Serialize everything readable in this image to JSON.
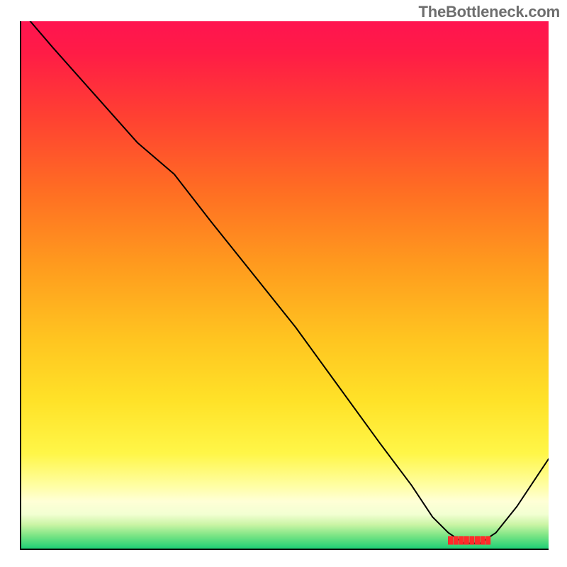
{
  "attribution": "TheBottleneck.com",
  "chart_data": {
    "type": "line",
    "title": "",
    "xlabel": "",
    "ylabel": "",
    "xlim": [
      0,
      100
    ],
    "ylim": [
      0,
      100
    ],
    "background_gradient": {
      "stops": [
        {
          "offset": 0.0,
          "color": "#ff1450"
        },
        {
          "offset": 0.06,
          "color": "#ff1c46"
        },
        {
          "offset": 0.18,
          "color": "#ff4032"
        },
        {
          "offset": 0.32,
          "color": "#ff6d23"
        },
        {
          "offset": 0.46,
          "color": "#ff9a1e"
        },
        {
          "offset": 0.6,
          "color": "#ffc420"
        },
        {
          "offset": 0.72,
          "color": "#ffe228"
        },
        {
          "offset": 0.82,
          "color": "#fff648"
        },
        {
          "offset": 0.88,
          "color": "#fffea2"
        },
        {
          "offset": 0.91,
          "color": "#ffffd6"
        },
        {
          "offset": 0.935,
          "color": "#f2ffd2"
        },
        {
          "offset": 0.955,
          "color": "#c9f4a4"
        },
        {
          "offset": 0.975,
          "color": "#7de585"
        },
        {
          "offset": 1.0,
          "color": "#1fcf76"
        }
      ]
    },
    "curve": {
      "x": [
        0,
        6,
        14,
        22,
        29,
        36,
        44,
        52,
        60,
        68,
        74,
        78,
        81,
        84,
        87,
        90,
        94,
        98,
        100
      ],
      "y": [
        102,
        95,
        86,
        77,
        71,
        62,
        52,
        42,
        31,
        20,
        12,
        6,
        3,
        1,
        1,
        3,
        8,
        14,
        17
      ]
    },
    "marker": {
      "x": 85,
      "y": 1.5,
      "label": "████████"
    }
  }
}
